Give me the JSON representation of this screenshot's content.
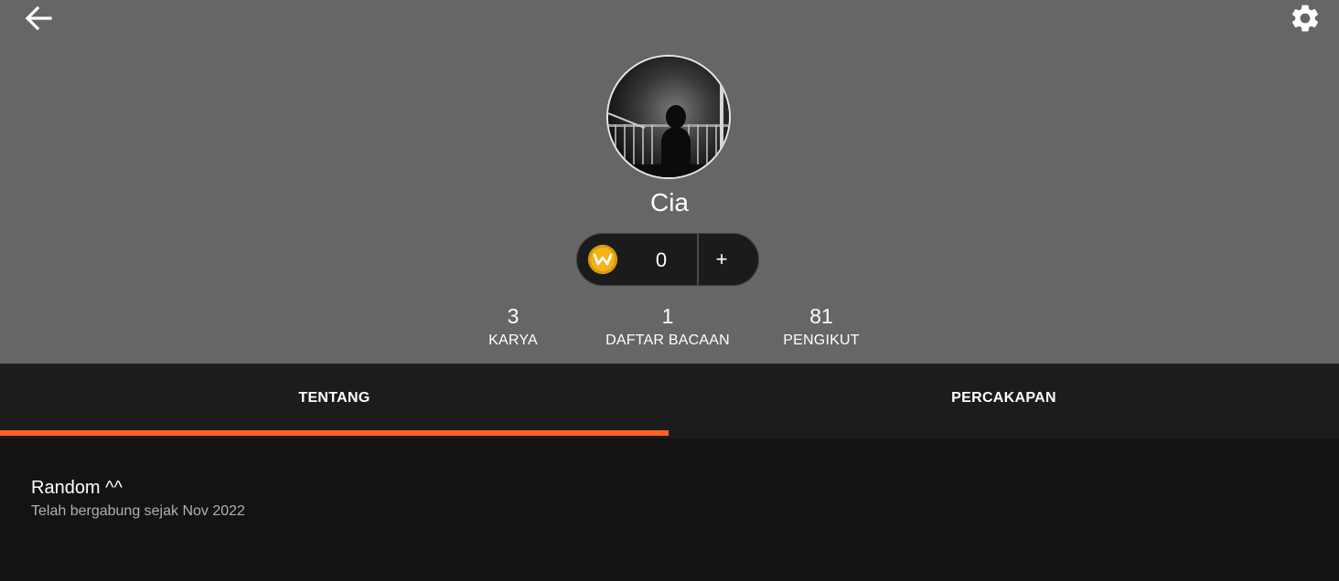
{
  "header": {
    "background_color": "#666666",
    "back_icon": "arrow-left-icon",
    "settings_icon": "gear-icon"
  },
  "profile": {
    "username": "Cia",
    "avatar": "silhouette-by-railing-photo"
  },
  "coins": {
    "icon": "wattpad-coin-icon",
    "count": "0",
    "add_label": "+"
  },
  "stats": [
    {
      "value": "3",
      "label": "KARYA"
    },
    {
      "value": "1",
      "label": "DAFTAR BACAAN"
    },
    {
      "value": "81",
      "label": "PENGIKUT"
    }
  ],
  "tabs": [
    {
      "label": "TENTANG",
      "active": true
    },
    {
      "label": "PERCAKAPAN",
      "active": false
    }
  ],
  "accent_color": "#ff6122",
  "about": {
    "bio": "Random ^^",
    "joined": "Telah bergabung sejak Nov 2022"
  }
}
